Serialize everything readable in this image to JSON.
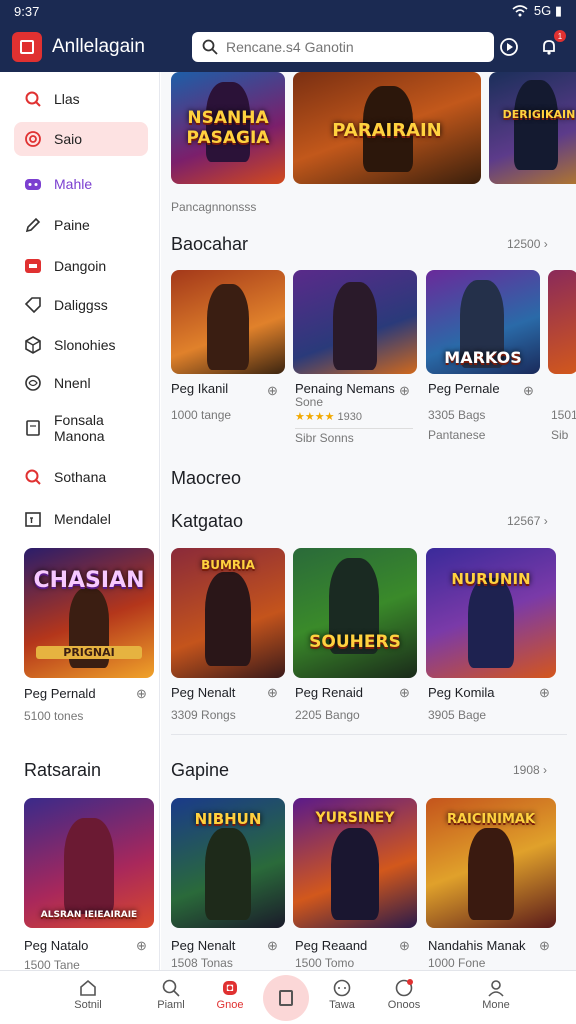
{
  "status_bar": {
    "time": "9:37",
    "right": "5G ▮"
  },
  "header": {
    "title": "Anllelagain",
    "search_placeholder": "Rencane.s4 Ganotin"
  },
  "sidebar": {
    "items": [
      {
        "label": "Llas",
        "icon": "search-icon"
      },
      {
        "label": "Saio",
        "icon": "spiral-icon"
      },
      {
        "label": "Mahle",
        "icon": "gamepad-icon"
      },
      {
        "label": "Paine",
        "icon": "pencil-icon"
      },
      {
        "label": "Dangoin",
        "icon": "controller-icon"
      },
      {
        "label": "Daliggss",
        "icon": "tag-icon"
      },
      {
        "label": "Slonohies",
        "icon": "cube-icon"
      },
      {
        "label": "Nnenl",
        "icon": "brain-icon"
      },
      {
        "label": "Fonsala Manona",
        "icon": "document-icon"
      },
      {
        "label": "Sothana",
        "icon": "search-icon"
      },
      {
        "label": "Mendalel",
        "icon": "calendar-icon"
      }
    ],
    "featured": {
      "art": "CHASIAN",
      "art2": "PRIGNAI",
      "name": "Peg Pernald",
      "sub": "5100 tones"
    },
    "section2_title": "Ratsarain",
    "featured2": {
      "art": "ALSRAN IEIEAIRAIE",
      "name": "Peg Natalo",
      "sub": "1500 Tane"
    }
  },
  "top_banners": [
    {
      "art": "NSANHA PASAGIA"
    },
    {
      "art": "PARAIRAIN"
    },
    {
      "art": "DERIGIKAIN"
    }
  ],
  "breadcrumb": "Pancagnnonsss",
  "sections": [
    {
      "title": "Baocahar",
      "count": "12500",
      "games": [
        {
          "name": "Peg Ikanil",
          "sub": "1000 tange",
          "art": ""
        },
        {
          "name": "Penaing Nemans",
          "sub2": "Sone",
          "rating": "1930",
          "sub": "Sibr Sonns",
          "art": ""
        },
        {
          "name": "Peg Pernale",
          "sub": "3305 Bags",
          "extra": "Pantanese",
          "art": "MARKOS"
        },
        {
          "name": "",
          "sub": "1501",
          "extra": "Sib",
          "art": ""
        }
      ]
    },
    {
      "title": "Maocreo"
    },
    {
      "title": "Katgatao",
      "count": "12567",
      "games": [
        {
          "name": "Peg Nenalt",
          "sub": "3309 Rongs",
          "art": "BUMRIA"
        },
        {
          "name": "Peg Renaid",
          "sub": "2205 Bango",
          "art": "SOUHERS"
        },
        {
          "name": "Peg Komila",
          "sub": "3905 Bage",
          "art": "NURUNIN"
        }
      ]
    },
    {
      "title": "Gapine",
      "count": "1908",
      "games": [
        {
          "name": "Peg Nenalt",
          "sub": "1508 Tonas",
          "art": "NIBHUN"
        },
        {
          "name": "Peg Reaand",
          "sub": "1500 Tomo",
          "art": "YURSINEY"
        },
        {
          "name": "Nandahis Manak",
          "sub": "1000 Fone",
          "art": "RAICINIMAK"
        }
      ]
    }
  ],
  "bottom_nav": [
    {
      "label": "Sotnil",
      "icon": "home-icon"
    },
    {
      "label": "Piaml",
      "icon": "search-icon"
    },
    {
      "label": "Gnoe",
      "icon": "gamepad-icon"
    },
    {
      "label": "",
      "icon": "plus-icon"
    },
    {
      "label": "Tawa",
      "icon": "chat-icon"
    },
    {
      "label": "Onoos",
      "icon": "notification-icon"
    },
    {
      "label": "Mone",
      "icon": "user-icon"
    }
  ],
  "colors": {
    "brand": "#e03131",
    "header": "#1b2a52"
  }
}
